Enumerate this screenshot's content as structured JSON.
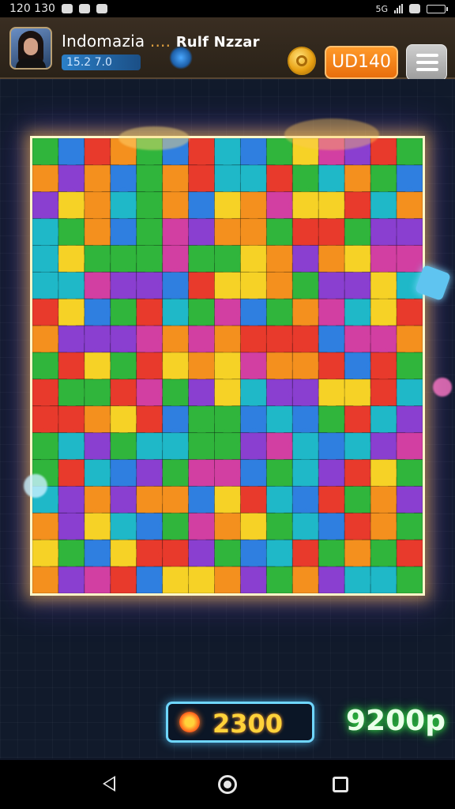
{
  "status_bar": {
    "time": "120 130",
    "network": "5G"
  },
  "header": {
    "player_name": "Indomazia",
    "player_name_suffix": "....",
    "partner_name": "Rulf Nzzar",
    "level_text": "15.2 7.0",
    "currency_amount": "UD140"
  },
  "board": {
    "columns": 15,
    "rows": 17,
    "palette": [
      "#e83a2c",
      "#f4901e",
      "#f6d226",
      "#30b53c",
      "#2f7fe0",
      "#8a3fd0",
      "#d23fa2",
      "#1fb8c8"
    ]
  },
  "footer": {
    "score": "2300",
    "points": "9200p"
  },
  "icons": {
    "coin": "coin-icon",
    "menu": "menu-icon",
    "score": "sun-icon",
    "nav_back": "back-icon",
    "nav_home": "home-icon",
    "nav_recent": "recent-apps-icon"
  }
}
